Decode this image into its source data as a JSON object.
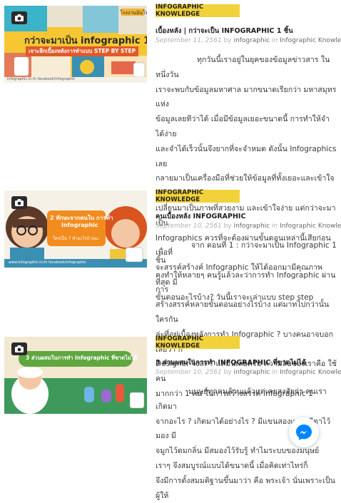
{
  "posts": [
    {
      "category": "INFOGRAPHIC KNOWLEDGE",
      "title": "เบื้องหลัง | กว่าจะเป็น INFOGRAPHIC 1 ชิ้น",
      "date": "September 11, 2561",
      "by": "by",
      "author": "infographic",
      "in": "in",
      "category_link": "Infographic Knowledge",
      "excerpt": "ทุกวันนี้เราอยู่ในยุคของข้อมูลข่าวสาร ในหนึ่งวัน\nเราจะพบกับข้อมูลมหาศาล มากขนาดเรียกว่า มหาสมุทรแห่ง\nข้อมูลเลยทีว่าได้ เมื่อมีข้อมูลเยอะขนาดนี้ การทำให้จำได้ง่าย\nและจำได้เร็วนั้นจึงยากที่จะจำหมด ดังนั้น Infographics เลย\nกลายมาเป็นเครื่องมือที่ช่วยให้ข้อมูลที่ทั้งเยอะและเข้าใจยาก\nเปลี่ยนมาเป็นภาพที่สวยงาม และเข้าใจง่าย แต่กว่าจะมาเป็น\nInfographics ควรที่จะต้องผ่านขั้นตอนเหล่านี้เสียก่อน เพื่อที่\nจะสรรค์สร้างค์ Infographic ให้ได้ออกมามีคุณภาพที่สุด มี\nขั้นตอนอะไรบ้าง? วันนี้เราจะเล่าแบบ step step",
      "thumb": {
        "banner_title": "กว่าจะมาเป็น infographic 1 ชิ้น",
        "banner_sub": "เจาะลึกเบื้องหลังการทำแบบ STEP BY STEP",
        "footer": "infographic.in.th facebook/infographic",
        "corner": "โรงงานอินโฟ"
      }
    },
    {
      "category": "INFOGRAPHIC KNOWLEDGE",
      "title": "คนเบื้องหลัง INFOGRAPHIC",
      "date": "September 10, 2561",
      "by": "by",
      "author": "infographic",
      "in": "in",
      "category_link": "Infographic Knowledge",
      "excerpt": "จาก ตอนที่ 1 : กว่าจะมาเป็น Infographic 1 ชิ้น\nคงทำให้หลายๆ คนรู้แล้วละว่าการทำ Infographic ผ่านการ\nสร้างสรรค์หลายขั้นตอนอย่างไรบ้าง แต่มาทไปกว่านั้น ใครกัน\nล่ะที่อยู่เบื้องหลังการทำ Infographic ? บางคนอาจบอกเลยว่า ก็\nDesigner ไงล่ะ ! แต่มีนเลยครับ ความลับของเราคือ ใช้คน\nมากกว่า 1 คน ในการสร้างสรรค์ Infographic 1",
      "thumb": {
        "banner_title": "2 ทักษะจากคนใน การทำ",
        "banner_title2": "Infographic",
        "banner_sub": "ใครเป็น ? ทำอะไรบ้างนะ",
        "footer": "www.infographic.in.th facebook/infographic"
      }
    },
    {
      "category": "INFOGRAPHIC KNOWLEDGE",
      "title": "3 ส่วนผสมในการทำ INFOGRAPHIC ที่ขาดไม่ได้",
      "date": "September 10, 2561",
      "by": "by",
      "author": "infographic",
      "in": "in",
      "category_link": "Infographic Knowledge",
      "excerpt": "มนุษย์ทุกคนล้วนแล้วแต่เคยสงสัยว่า คนเราเกิดมา\nจากอะไร ? เกิดมาได้อย่างไร ? มีแขนสองแขน มีตาไว้มอง มี\nจมูกไว้ดมกลิ่น มีสมองไว้รับรู้ ทำไมระบบของมนุษย์\nเราๆ จึงสมบูรณ์แบบได้ขนาดนี้ เมื่อคิดเท่าไหร่ก็\nจึงมีการตั้งสมมติฐานขึ้นมาว่า คือ พระเจ้า นั่นเพราะเป็นผู้ให้",
      "thumb": {
        "banner_title": "3 ส่วนผสมในการทำ Infographic ที่ขาดไม่ได้",
        "footer": "infographic.in.th"
      }
    }
  ],
  "colors": {
    "badge": "#f2d23a",
    "messenger": "#0084ff"
  },
  "icons": {
    "thumb_corner": "camera-icon",
    "chat": "messenger-icon"
  }
}
